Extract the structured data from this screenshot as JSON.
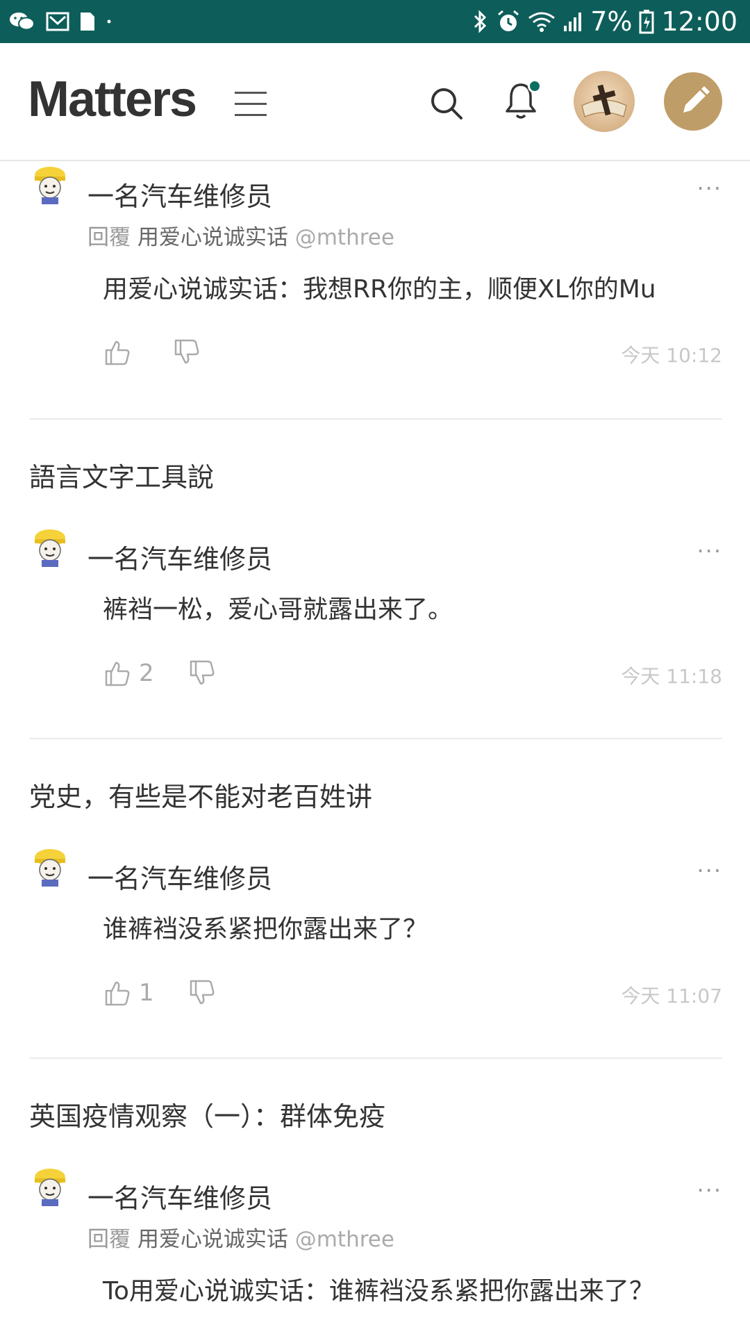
{
  "status_bar": {
    "battery": "7%",
    "time": "12:00",
    "icons": [
      "wechat-icon",
      "mail-icon",
      "sim-icon",
      "bluetooth-icon",
      "alarm-icon",
      "wifi-icon",
      "signal-icon",
      "battery-icon"
    ]
  },
  "header": {
    "logo": "Matters",
    "icons": [
      "menu-icon",
      "search-icon",
      "bell-icon",
      "avatar",
      "pencil-icon"
    ],
    "accent_color": "#bf9d68",
    "notification_dot_color": "#0d6e62"
  },
  "threads": [
    {
      "comments": [
        {
          "author": "一名汽车维修员",
          "more": "···",
          "reply_prefix": "回覆",
          "reply_to": "用爱心说诚实话",
          "reply_handle": "@mthree",
          "body": "用爱心说诚实话：我想RR你的主，顺便XL你的Mu",
          "likes": "",
          "time": "今天 10:12"
        }
      ]
    },
    {
      "title": "語言文字工具說",
      "comments": [
        {
          "author": "一名汽车维修员",
          "more": "···",
          "body": "裤裆一松，爱心哥就露出来了。",
          "likes": "2",
          "time": "今天 11:18"
        }
      ]
    },
    {
      "title": "党史，有些是不能对老百姓讲",
      "comments": [
        {
          "author": "一名汽车维修员",
          "more": "···",
          "body": "谁裤裆没系紧把你露出来了？",
          "likes": "1",
          "time": "今天 11:07"
        }
      ]
    },
    {
      "title": "英国疫情观察（一）：群体免疫",
      "comments": [
        {
          "author": "一名汽车维修员",
          "more": "···",
          "reply_prefix": "回覆",
          "reply_to": "用爱心说诚实话",
          "reply_handle": "@mthree",
          "body": "To用爱心说诚实话：谁裤裆没系紧把你露出来了？"
        }
      ]
    }
  ]
}
